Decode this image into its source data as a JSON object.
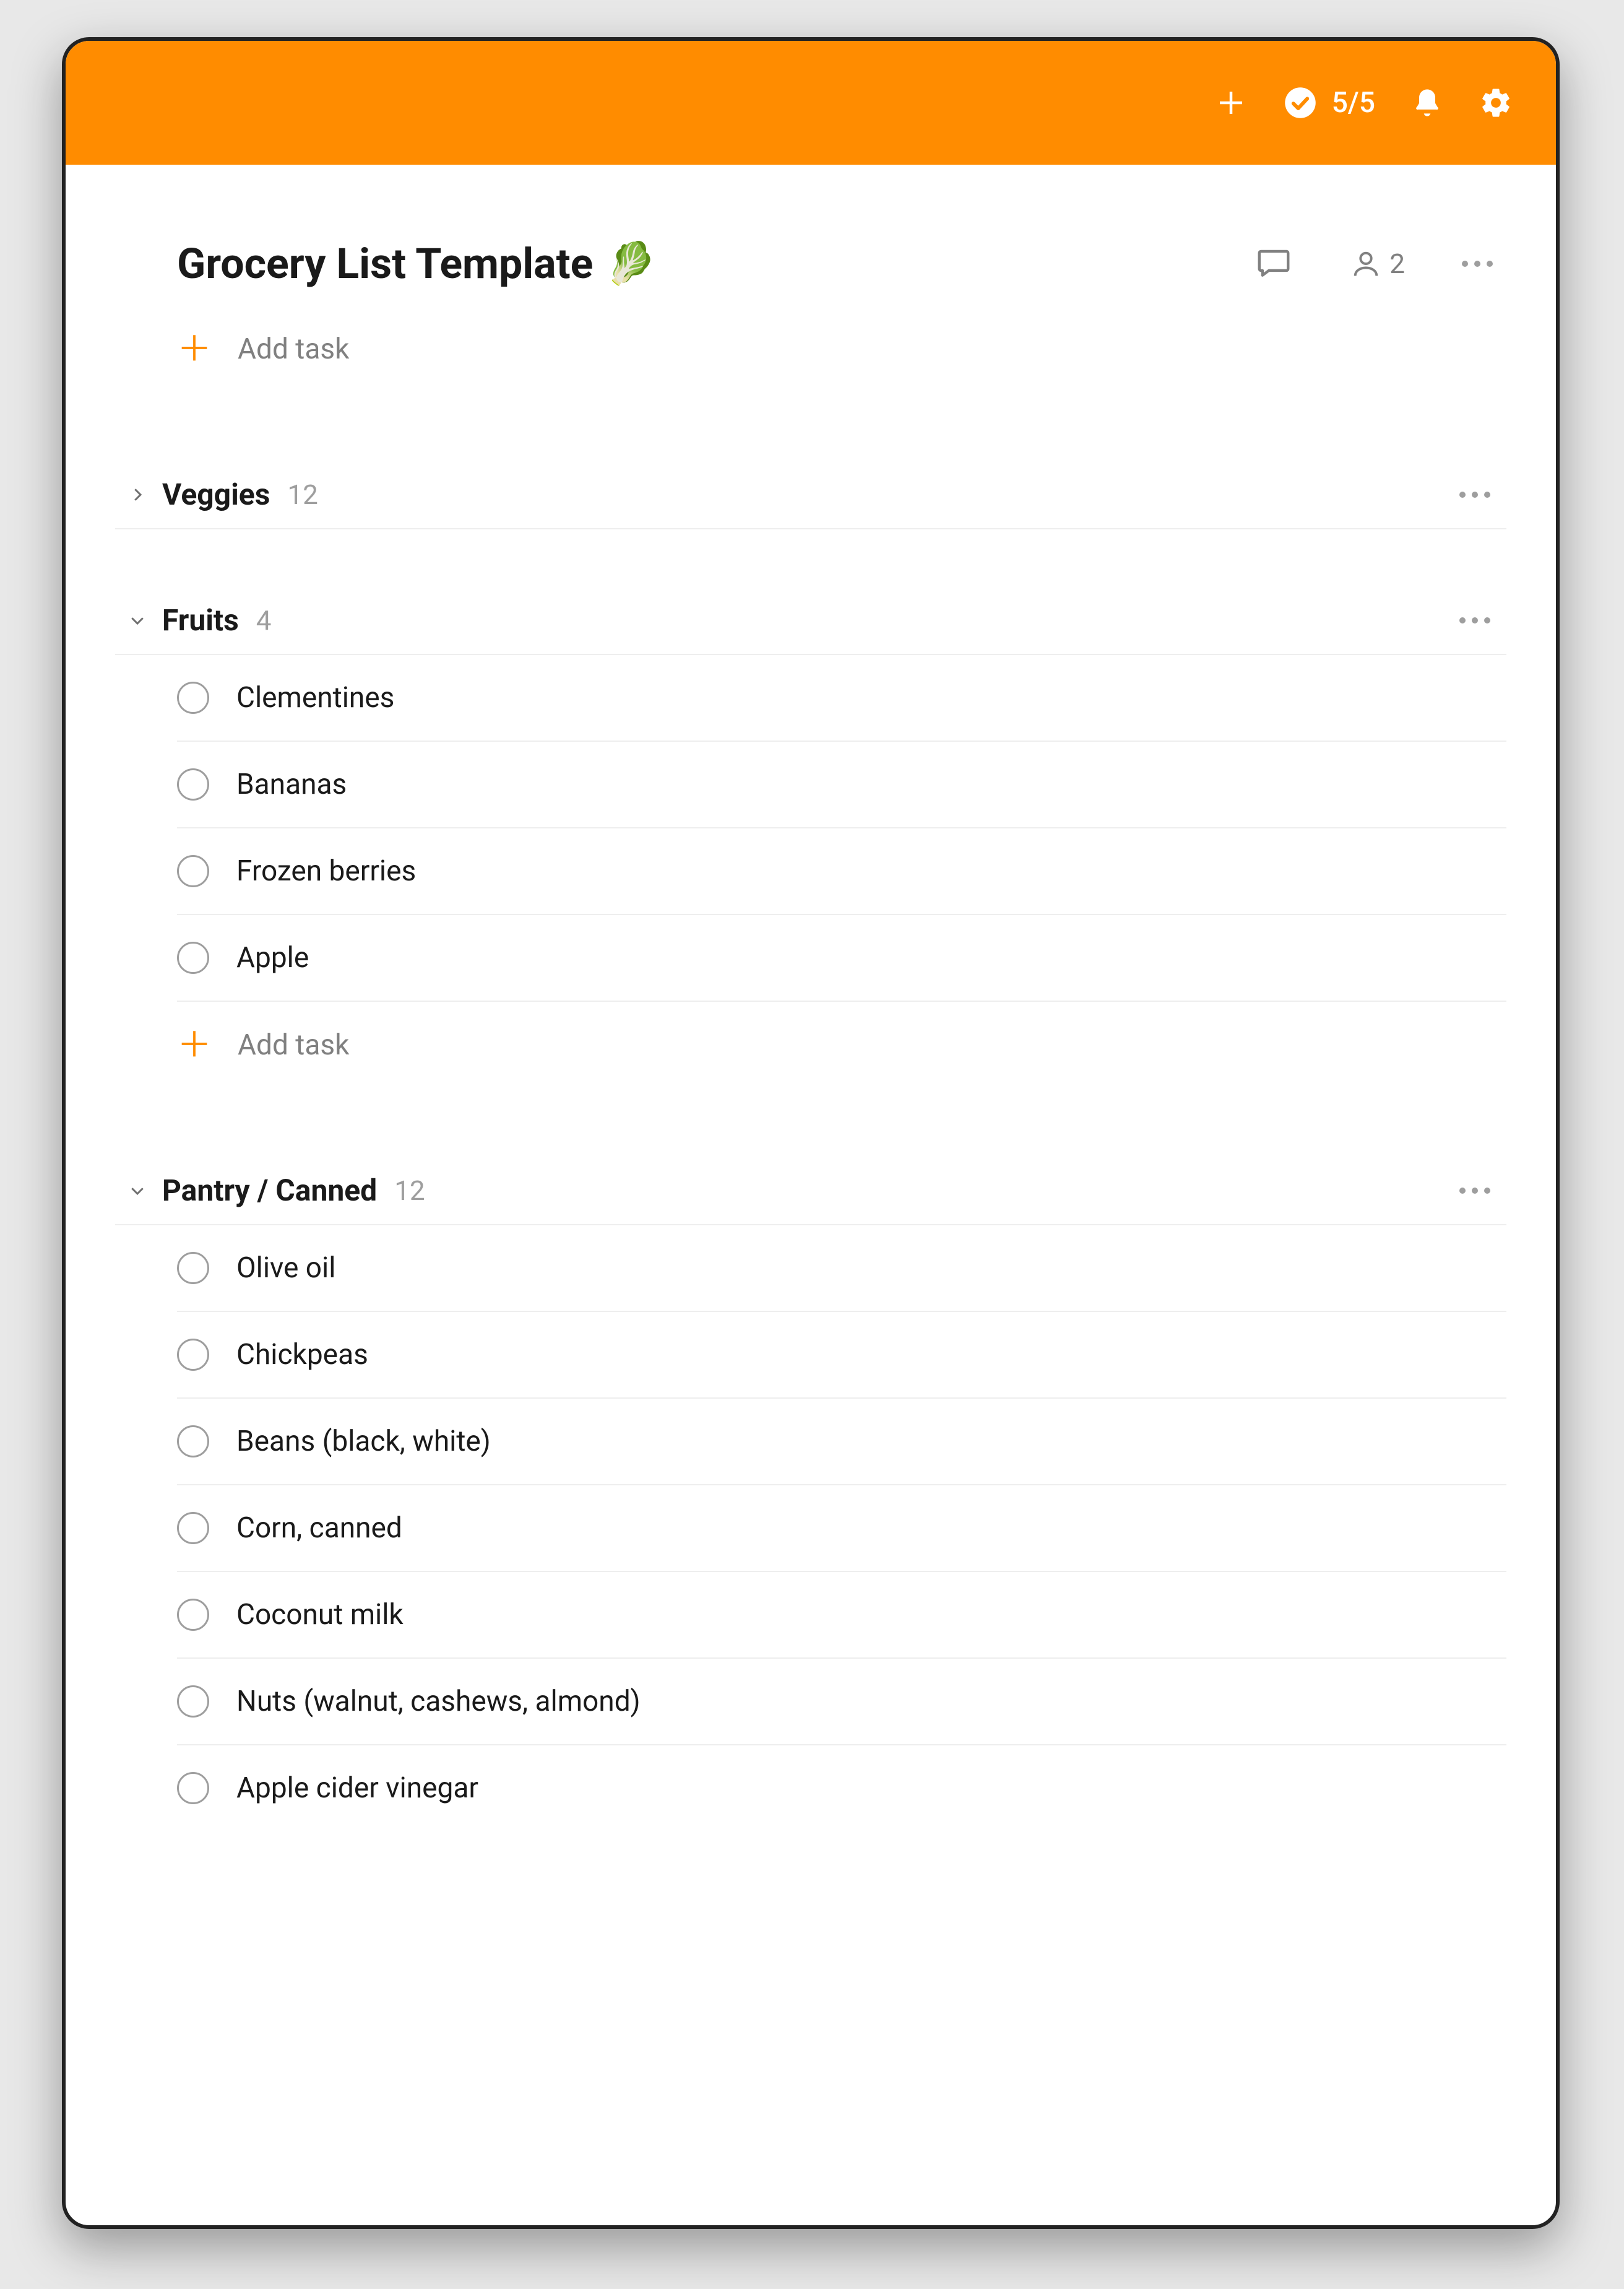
{
  "topbar": {
    "karma": "5/5"
  },
  "page": {
    "title": "Grocery List Template",
    "emoji": "🥬",
    "share_count": "2",
    "add_task_label": "Add task"
  },
  "sections": [
    {
      "name": "Veggies",
      "count": "12",
      "expanded": false,
      "tasks": []
    },
    {
      "name": "Fruits",
      "count": "4",
      "expanded": true,
      "tasks": [
        {
          "label": "Clementines"
        },
        {
          "label": "Bananas"
        },
        {
          "label": "Frozen berries"
        },
        {
          "label": "Apple"
        }
      ],
      "add_task_label": "Add task"
    },
    {
      "name": "Pantry / Canned",
      "count": "12",
      "expanded": true,
      "tasks": [
        {
          "label": "Olive oil"
        },
        {
          "label": "Chickpeas"
        },
        {
          "label": "Beans (black, white)"
        },
        {
          "label": "Corn, canned"
        },
        {
          "label": "Coconut milk"
        },
        {
          "label": "Nuts (walnut, cashews, almond)"
        },
        {
          "label": "Apple cider vinegar"
        }
      ]
    }
  ]
}
